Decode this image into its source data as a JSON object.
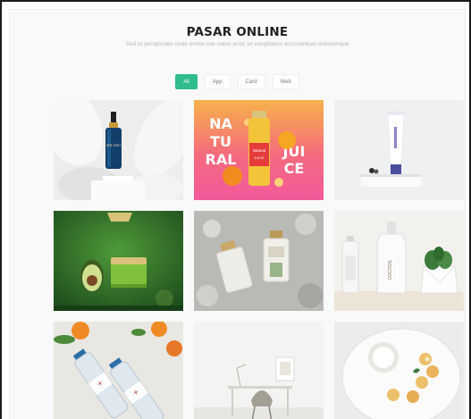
{
  "header": {
    "title": "PASAR ONLINE",
    "subtitle": "Sed ut perspiciatis unde omnis iste natus error sit voluptatem accusantium doloremque"
  },
  "filters": [
    {
      "label": "All",
      "active": true
    },
    {
      "label": "App",
      "active": false
    },
    {
      "label": "Card",
      "active": false
    },
    {
      "label": "Web",
      "active": false
    }
  ],
  "portfolio": {
    "items": [
      {
        "label": "MILANO"
      },
      {
        "label": "Natural",
        "extra": "JUICE"
      },
      {
        "label": ""
      },
      {
        "label": ""
      },
      {
        "label": ""
      },
      {
        "label": "COCOOIL"
      },
      {
        "label": ""
      },
      {
        "label": ""
      },
      {
        "label": ""
      }
    ]
  },
  "colors": {
    "accent": "#2fbd8e"
  }
}
